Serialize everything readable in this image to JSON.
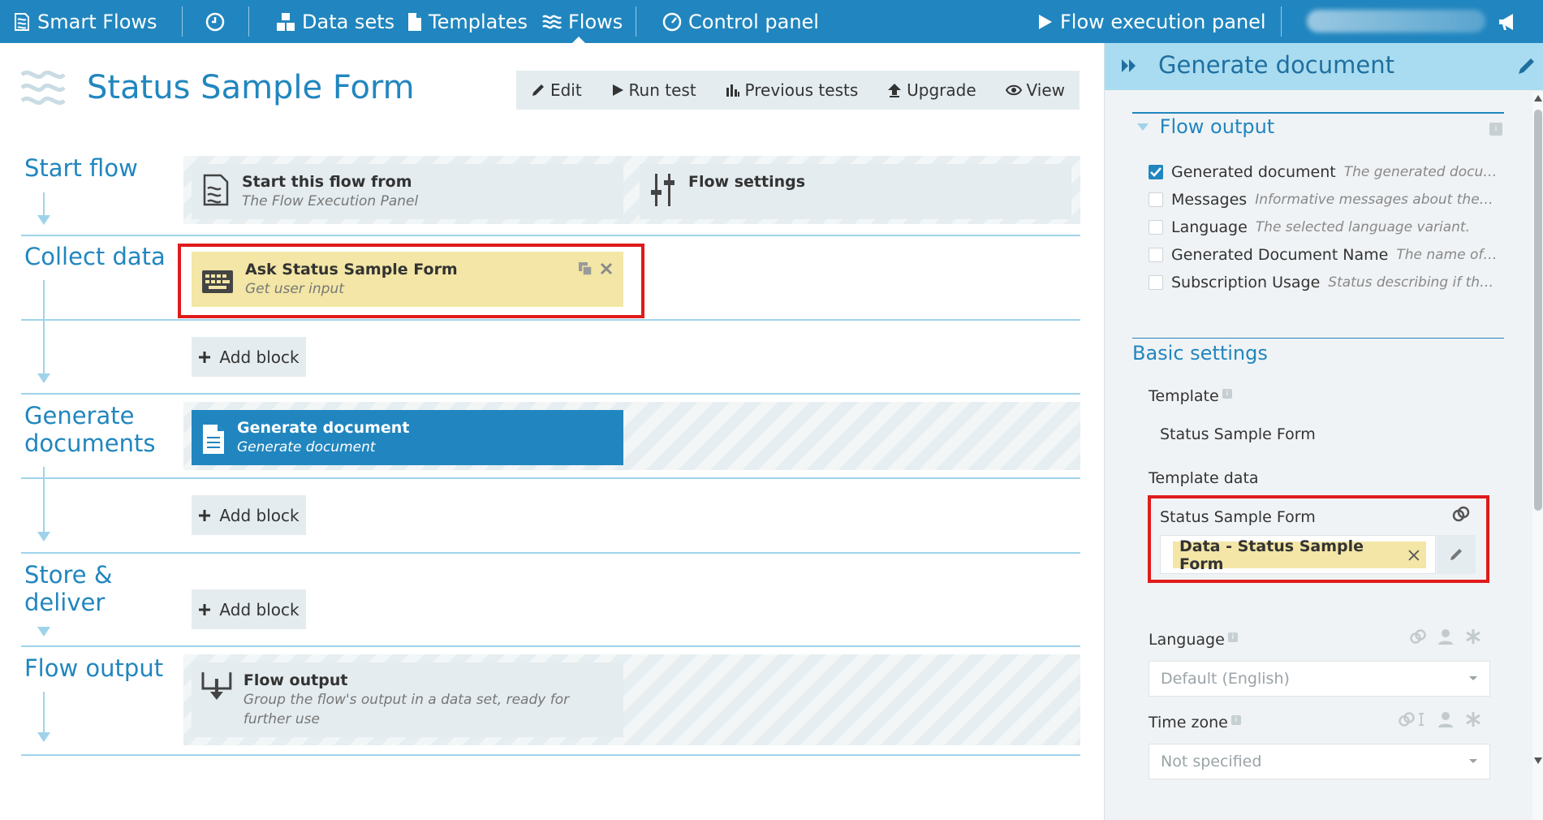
{
  "nav": {
    "brand": "Smart Flows",
    "datasets": "Data sets",
    "templates": "Templates",
    "flows": "Flows",
    "control_panel": "Control panel",
    "flow_execution_panel": "Flow execution panel"
  },
  "page": {
    "title": "Status Sample Form",
    "toolbar": {
      "edit": "Edit",
      "run_test": "Run test",
      "previous_tests": "Previous tests",
      "upgrade": "Upgrade",
      "view": "View"
    }
  },
  "sections": {
    "start_flow": "Start flow",
    "collect_data": "Collect data",
    "generate_documents": [
      "Generate",
      "documents"
    ],
    "store_deliver": [
      "Store &",
      "deliver"
    ],
    "flow_output": "Flow output"
  },
  "blocks": {
    "start_from": {
      "title": "Start this flow from",
      "subtitle": "The Flow Execution Panel"
    },
    "flow_settings": {
      "title": "Flow settings"
    },
    "ask_form": {
      "title": "Ask Status Sample Form",
      "subtitle": "Get user input"
    },
    "generate_doc": {
      "title": "Generate document",
      "subtitle": "Generate document"
    },
    "flow_output": {
      "title": "Flow output",
      "subtitle": "Group the flow's output in a data set, ready for further use"
    },
    "add_block": "Add block"
  },
  "panel": {
    "title": "Generate document",
    "flow_output_heading": "Flow output",
    "outputs": [
      {
        "name": "Generated document",
        "desc": "The generated docum...",
        "checked": true
      },
      {
        "name": "Messages",
        "desc": "Informative messages about the do...",
        "checked": false
      },
      {
        "name": "Language",
        "desc": "The selected language variant.",
        "checked": false
      },
      {
        "name": "Generated Document Name",
        "desc": "The name of th...",
        "checked": false
      },
      {
        "name": "Subscription Usage",
        "desc": "Status describing if the ...",
        "checked": false
      }
    ],
    "basic_settings_heading": "Basic settings",
    "template_label": "Template",
    "template_value": "Status Sample Form",
    "template_data_label": "Template data",
    "template_data_item_label": "Status Sample Form",
    "template_data_tag": "Data - Status Sample Form",
    "language_label": "Language",
    "language_value": "Default (English)",
    "timezone_label": "Time zone",
    "timezone_value": "Not specified"
  },
  "colors": {
    "nav_bg": "#2186bf",
    "accent": "#2186bf",
    "panel_header": "#a9dcf0",
    "highlight_red": "#e01b1b",
    "yellow_block": "#f3e6a6"
  }
}
